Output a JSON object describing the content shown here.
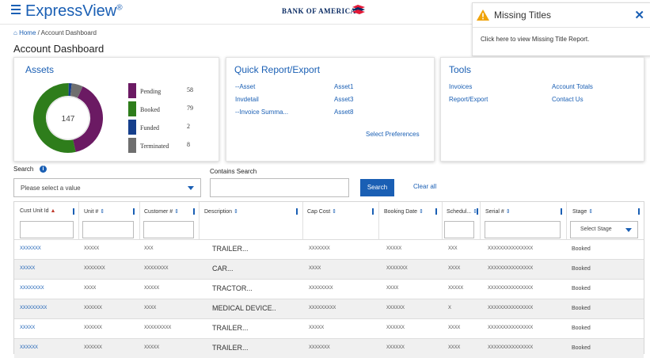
{
  "app": {
    "brand": "ExpressView",
    "brand_mark": "®",
    "bank_name": "BANK OF AMERICA"
  },
  "breadcrumb": {
    "home": "Home",
    "separator": "/",
    "current": "Account Dashboard"
  },
  "page_title": "Account Dashboard",
  "notification": {
    "title": "Missing Titles",
    "close": "✕",
    "message": "Click here to view Missing Title Report."
  },
  "assets": {
    "title": "Assets",
    "total": "147",
    "legend": [
      {
        "label": "Pending",
        "value": "58",
        "color": "#6b1a63"
      },
      {
        "label": "Booked",
        "value": "79",
        "color": "#2e7d1b"
      },
      {
        "label": "Funded",
        "value": "2",
        "color": "#163f8c"
      },
      {
        "label": "Terminated",
        "value": "8",
        "color": "#6f6f6f"
      }
    ]
  },
  "quick_report": {
    "title": "Quick Report/Export",
    "col1": [
      "--Asset",
      "Invdetail",
      "--Invoice Summa..."
    ],
    "col2": [
      "Asset1",
      "Asset3",
      "Asset8"
    ],
    "preferences": "Select Preferences"
  },
  "tools": {
    "title": "Tools",
    "col1": [
      "Invoices",
      "Report/Export"
    ],
    "col2": [
      "Account Totals",
      "Contact Us"
    ]
  },
  "search": {
    "label": "Search",
    "info": "i",
    "select_value": "Please select a value",
    "contains_label": "Contains Search",
    "button": "Search",
    "clear": "Clear all"
  },
  "table": {
    "columns": [
      {
        "label": "Cust Unit Id",
        "sort": "▲"
      },
      {
        "label": "Unit #",
        "sort": "⇕"
      },
      {
        "label": "Customer #",
        "sort": "⇕"
      },
      {
        "label": "Description",
        "sort": "⇕"
      },
      {
        "label": "Cap Cost",
        "sort": "⇕"
      },
      {
        "label": "Booking Date",
        "sort": "⇕"
      },
      {
        "label": "Schedul...",
        "sort": "⇕"
      },
      {
        "label": "Serial #",
        "sort": "⇕"
      },
      {
        "label": "Stage",
        "sort": "⇕"
      }
    ],
    "stage_select": "Select Stage",
    "rows": [
      [
        "XXXXXXX",
        "XXXXX",
        "XXX",
        "TRAILER...",
        "XXXXXXX",
        "XXXXX",
        "XXX",
        "XXXXXXXXXXXXXXX",
        "Booked"
      ],
      [
        "XXXXX",
        "XXXXXXX",
        "XXXXXXXX",
        "CAR...",
        "XXXX",
        "XXXXXXX",
        "XXXX",
        "XXXXXXXXXXXXXXX",
        "Booked"
      ],
      [
        "XXXXXXXX",
        "XXXX",
        "XXXXX",
        "TRACTOR...",
        "XXXXXXXX",
        "XXXX",
        "XXXXX",
        "XXXXXXXXXXXXXXX",
        "Booked"
      ],
      [
        "XXXXXXXXX",
        "XXXXXX",
        "XXXX",
        "MEDICAL DEVICE..",
        "XXXXXXXXX",
        "XXXXXX",
        "X",
        "XXXXXXXXXXXXXXX",
        "Booked"
      ],
      [
        "XXXXX",
        "XXXXXX",
        "XXXXXXXXX",
        "TRAILER...",
        "XXXXX",
        "XXXXXX",
        "XXXX",
        "XXXXXXXXXXXXXXX",
        "Booked"
      ],
      [
        "XXXXXX",
        "XXXXXX",
        "XXXXX",
        "TRAILER...",
        "XXXXXXX",
        "XXXXXX",
        "XXXX",
        "XXXXXXXXXXXXXXX",
        "Booked"
      ]
    ]
  },
  "colors": {
    "accent": "#1a5fb4",
    "warning": "#f0a30a"
  }
}
